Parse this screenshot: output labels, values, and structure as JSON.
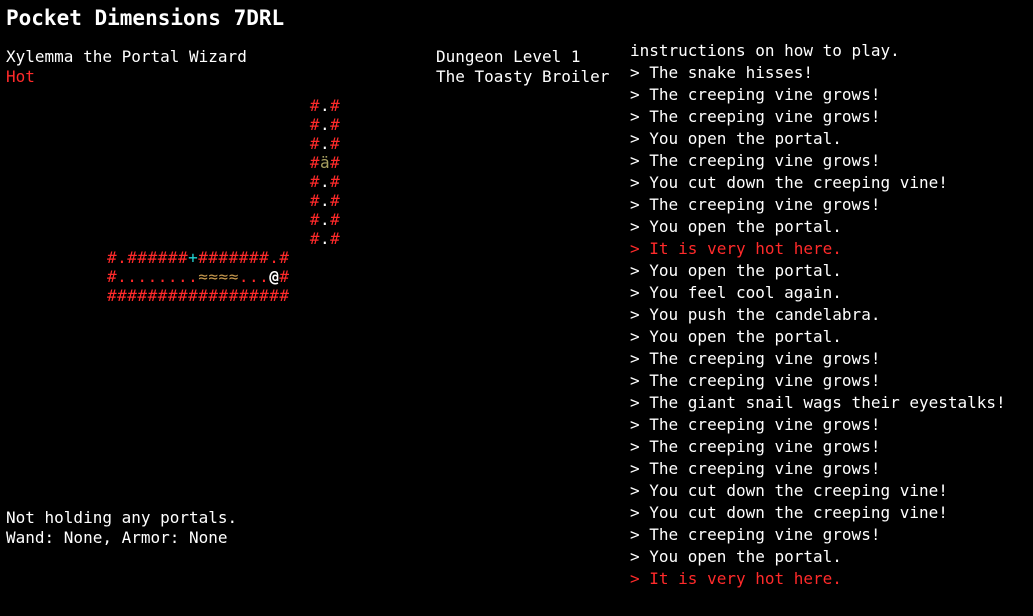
{
  "title": "Pocket Dimensions 7DRL",
  "character": {
    "name": "Xylemma the Portal Wizard",
    "status": "Hot"
  },
  "dungeon": {
    "level": "Dungeon Level 1",
    "name": "The Toasty Broiler"
  },
  "inventory": {
    "portals": "Not holding any portals.",
    "equipment": "Wand: None, Armor: None"
  },
  "colors": {
    "wall": "#ff2a2a",
    "warning_text": "#ff2a2a",
    "door": "#22d3d3",
    "lava": "#c99a4e",
    "item": "#a8a060",
    "text": "#ffffff",
    "background": "#000000"
  },
  "map": {
    "rows": [
      "                    #.#",
      "                    #.#",
      "                    #.#",
      "                    #ä#",
      "                    #.#",
      "                    #.#",
      "                    #.#",
      "                    #.#",
      "#.######+#######.#",
      "#........≈≈≈≈...@#",
      "##################"
    ]
  },
  "log": [
    {
      "text": "instructions on how to play.",
      "warn": false
    },
    {
      "text": "> The snake hisses!",
      "warn": false
    },
    {
      "text": "> The creeping vine grows!",
      "warn": false
    },
    {
      "text": "> The creeping vine grows!",
      "warn": false
    },
    {
      "text": "> You open the portal.",
      "warn": false
    },
    {
      "text": "> The creeping vine grows!",
      "warn": false
    },
    {
      "text": "> You cut down the creeping vine!",
      "warn": false
    },
    {
      "text": "> The creeping vine grows!",
      "warn": false
    },
    {
      "text": "> You open the portal.",
      "warn": false
    },
    {
      "text": "> It is very hot here.",
      "warn": true
    },
    {
      "text": "> You open the portal.",
      "warn": false
    },
    {
      "text": "> You feel cool again.",
      "warn": false
    },
    {
      "text": "> You push the candelabra.",
      "warn": false
    },
    {
      "text": "> You open the portal.",
      "warn": false
    },
    {
      "text": "> The creeping vine grows!",
      "warn": false
    },
    {
      "text": "> The creeping vine grows!",
      "warn": false
    },
    {
      "text": "> The giant snail wags their eyestalks!",
      "warn": false
    },
    {
      "text": "> The creeping vine grows!",
      "warn": false
    },
    {
      "text": "> The creeping vine grows!",
      "warn": false
    },
    {
      "text": "> The creeping vine grows!",
      "warn": false
    },
    {
      "text": "> You cut down the creeping vine!",
      "warn": false
    },
    {
      "text": "> You cut down the creeping vine!",
      "warn": false
    },
    {
      "text": "> The creeping vine grows!",
      "warn": false
    },
    {
      "text": "> You open the portal.",
      "warn": false
    },
    {
      "text": "> It is very hot here.",
      "warn": true
    }
  ]
}
